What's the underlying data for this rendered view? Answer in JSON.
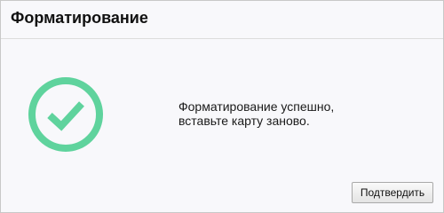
{
  "dialog": {
    "title": "Форматирование",
    "message_line1": "Форматирование успешно,",
    "message_line2": "вставьте карту заново.",
    "confirm_label": "Подтвердить",
    "icon": "check-circle-icon"
  },
  "colors": {
    "success": "#5fd39d"
  }
}
